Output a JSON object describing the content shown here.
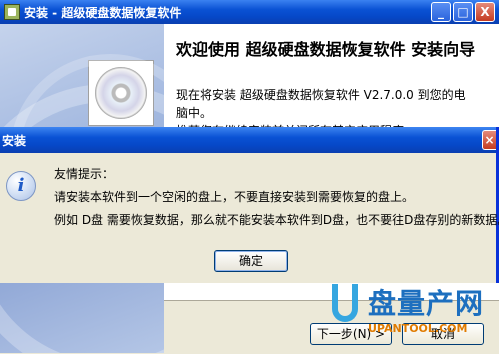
{
  "window": {
    "title": "安装 - 超级硬盘数据恢复软件",
    "minimize": "_",
    "maximize": "□",
    "close": "X"
  },
  "wizard": {
    "heading": "欢迎使用 超级硬盘数据恢复软件 安装向导",
    "description": "现在将安装 超级硬盘数据恢复软件 V2.7.0.0 到您的电脑中。",
    "partial_line": "推荐您在继续安装前关闭所有其它应用程序。",
    "next_button": "下一步(N) >",
    "cancel_button": "取消"
  },
  "dialog": {
    "title": "安装",
    "close": "×",
    "icon_glyph": "i",
    "heading": "友情提示：",
    "line1": "请安装本软件到一个空闲的盘上，不要直接安装到需要恢复的盘上。",
    "line2": "例如 D盘 需要恢复数据，那么就不能安装本软件到D盘，也不要往D盘存别的新数据。",
    "ok_button": "确定"
  },
  "watermark": {
    "brand": "盘量产网",
    "site": "UPANTOOL.COM"
  }
}
